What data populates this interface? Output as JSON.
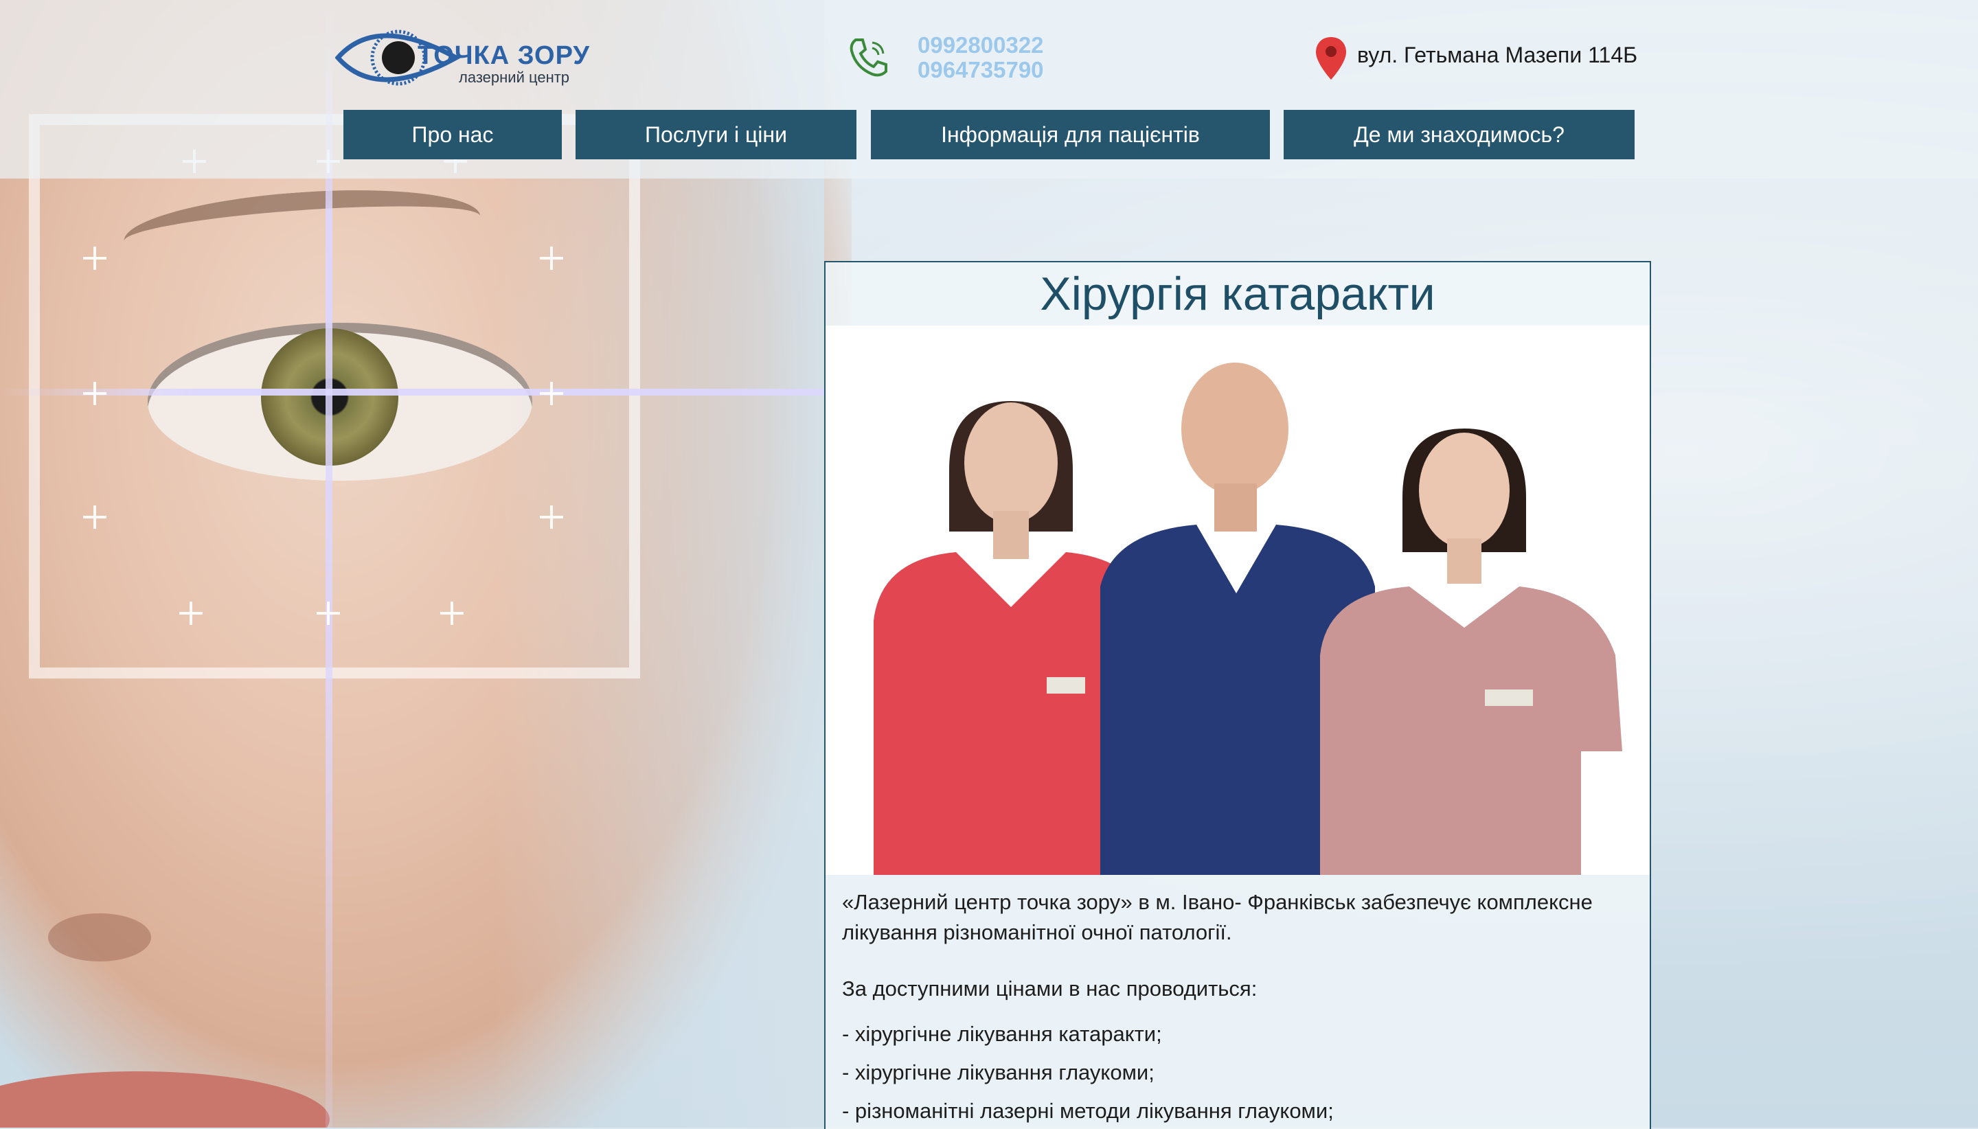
{
  "logo": {
    "title": "ТОЧКА ЗОРУ",
    "subtitle": "лазерний центр"
  },
  "contacts": {
    "phones": [
      "0992800322",
      "0964735790"
    ],
    "address": "вул. Гетьмана Мазепи 114Б"
  },
  "nav": {
    "items": [
      {
        "label": "Про нас"
      },
      {
        "label": "Послуги і ціни"
      },
      {
        "label": "Інформація для пацієнтів"
      },
      {
        "label": "Де ми знаходимось?"
      }
    ]
  },
  "main": {
    "title": "Хірургія катаракти",
    "intro": "«Лазерний центр точка зору» в м. Івано- Франківськ забезпечує комплексне лікування різноманітної очної патології.",
    "services_heading": "За доступними цінами в нас проводиться:",
    "services": [
      "- хірургічне лікування катаракти;",
      "- хірургічне лікування глаукоми;",
      "- різноманітні лазерні методи лікування глаукоми;"
    ]
  },
  "colors": {
    "nav_bg": "#25566e",
    "logo_blue": "#2d63a6",
    "phone_text": "#9cc8ec",
    "pin_red": "#e23b3b",
    "phone_green": "#3b8a3b"
  }
}
